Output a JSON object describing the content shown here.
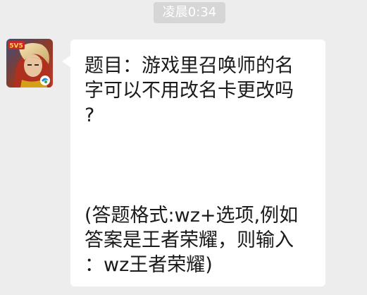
{
  "timestamp": "凌晨0:34",
  "avatar": {
    "badge_text": "5V5",
    "icon": "game-hero-avatar-icon"
  },
  "message": {
    "question_lines": [
      "题目：游戏里召唤师的名",
      "字可以不用改名卡更改吗",
      "?"
    ],
    "instruction_lines": [
      "(答题格式:wz+选项,例如",
      "答案是王者荣耀，则输入",
      "：wz王者荣耀)"
    ]
  },
  "colors": {
    "background": "#ededed",
    "bubble": "#ffffff",
    "timestamp_bg": "#d6d6d6",
    "text": "#1a1a1a"
  }
}
